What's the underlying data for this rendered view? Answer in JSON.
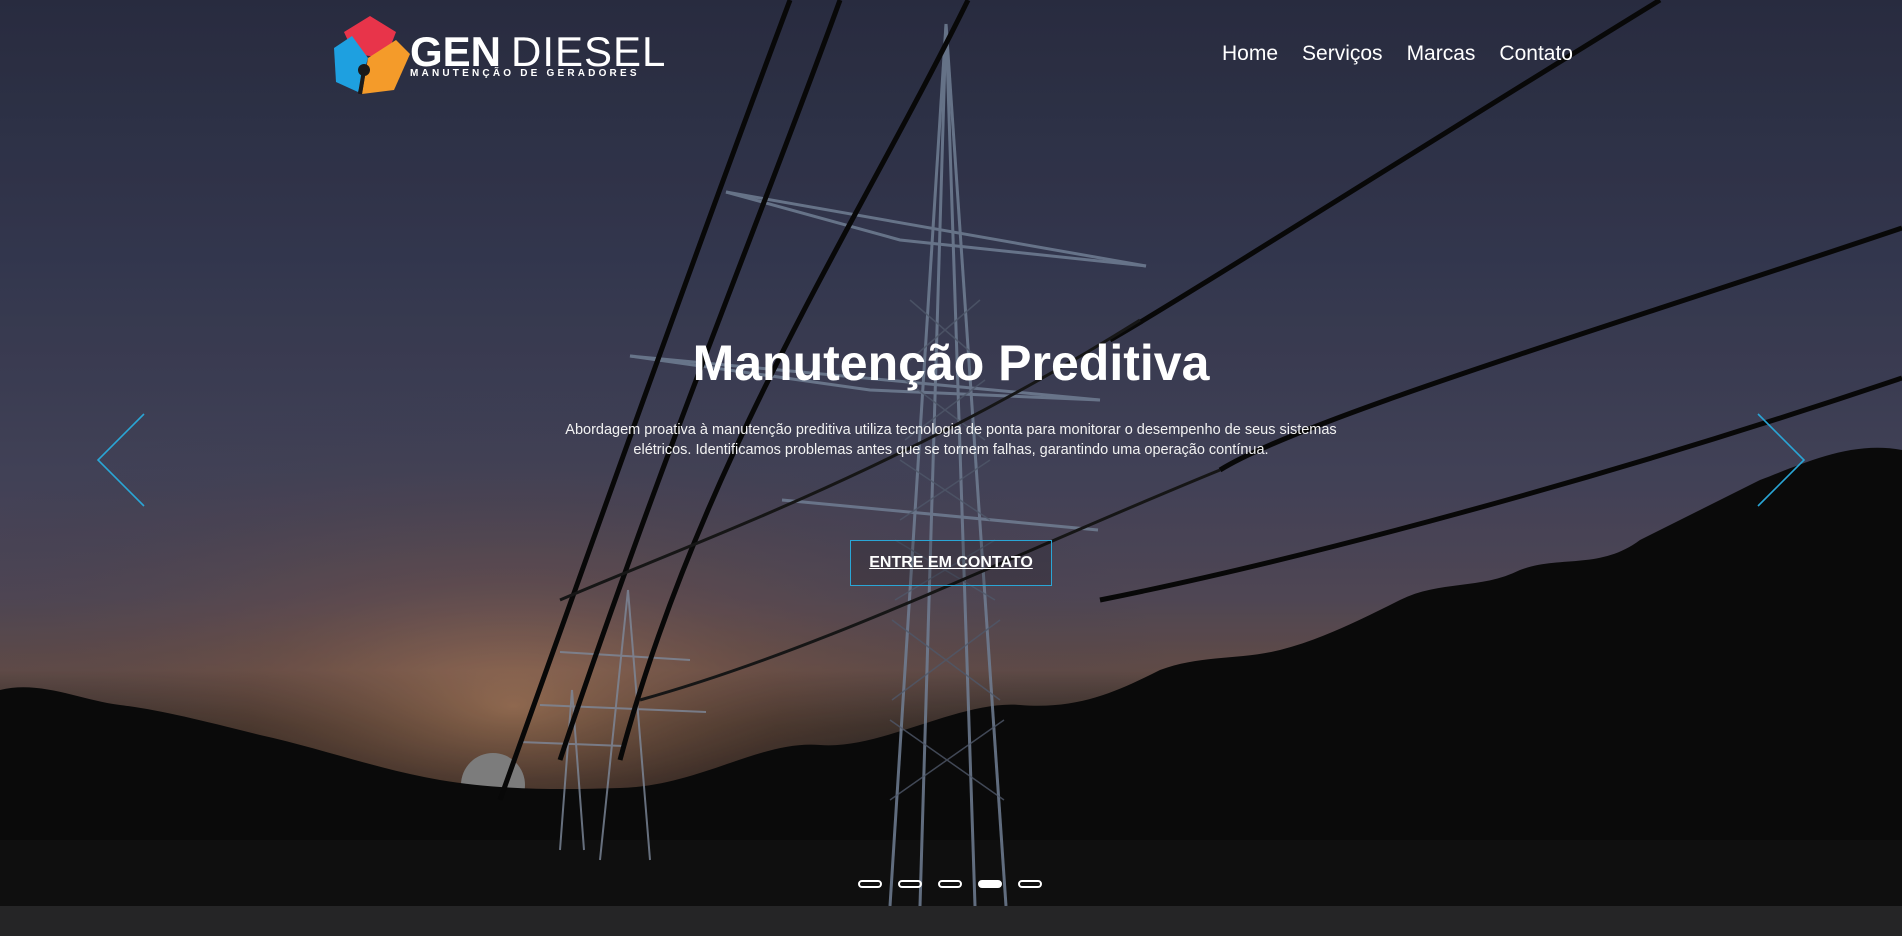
{
  "brand": {
    "name_bold": "GEN",
    "name_light": "DIESEL",
    "tagline": "MANUTENÇÃO DE GERADORES",
    "colors": {
      "red": "#e8344a",
      "blue": "#1ea0e0",
      "orange": "#f49b2a"
    }
  },
  "nav": {
    "items": [
      {
        "label": "Home"
      },
      {
        "label": "Serviços"
      },
      {
        "label": "Marcas"
      },
      {
        "label": "Contato"
      }
    ]
  },
  "hero": {
    "title": "Manutenção Preditiva",
    "description": "Abordagem proativa à manutenção preditiva utiliza tecnologia de ponta para monitorar o desempenho de seus sistemas elétricos. Identificamos problemas antes que se tornem falhas, garantindo uma operação contínua.",
    "cta_label": "ENTRE EM CONTATO",
    "accent": "#2aa6d6",
    "prev_icon": "chevron-left-icon",
    "next_icon": "chevron-right-icon"
  },
  "carousel": {
    "slide_count": 5,
    "active_index": 3
  }
}
